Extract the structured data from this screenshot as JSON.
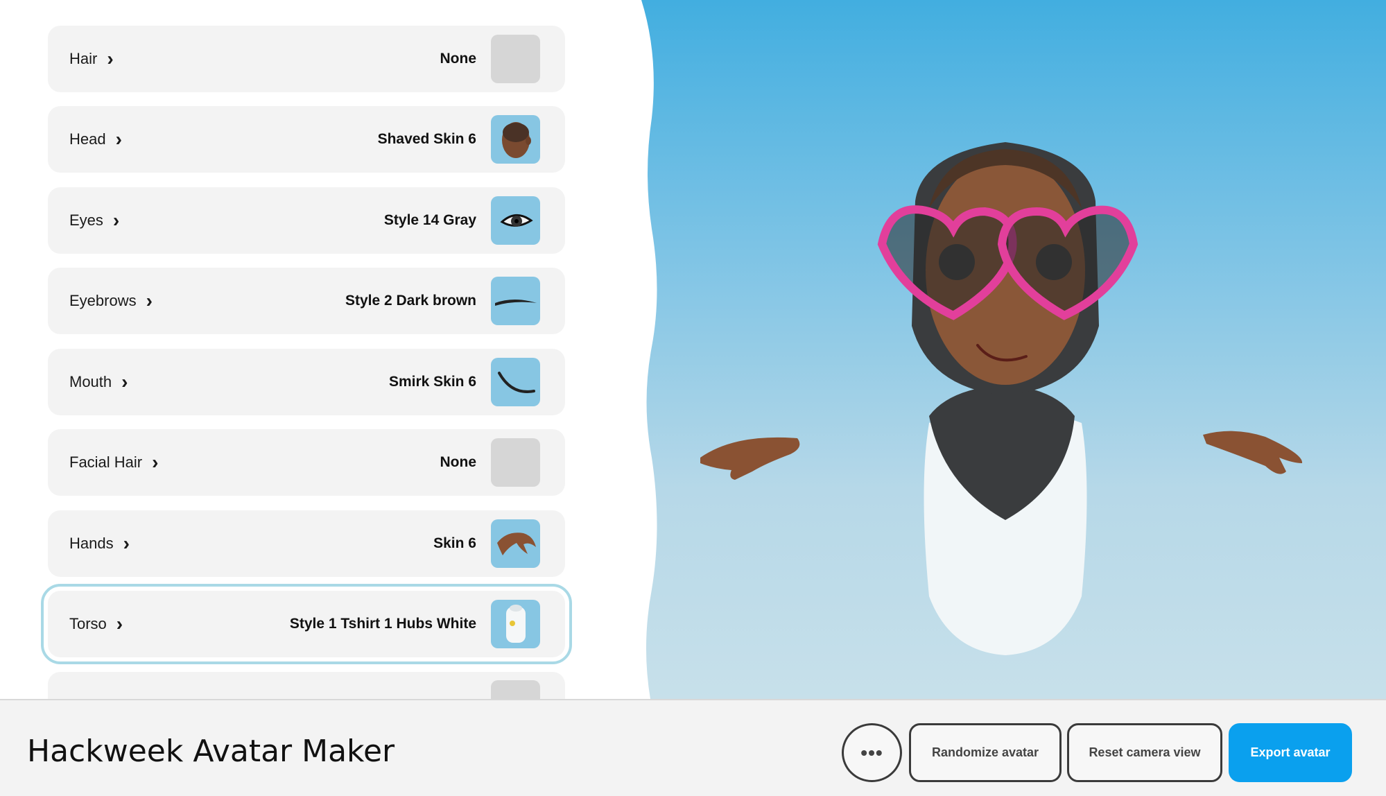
{
  "rows": [
    {
      "label": "Hair",
      "value": "None"
    },
    {
      "label": "Head",
      "value": "Shaved Skin 6"
    },
    {
      "label": "Eyes",
      "value": "Style 14 Gray"
    },
    {
      "label": "Eyebrows",
      "value": "Style 2 Dark brown"
    },
    {
      "label": "Mouth",
      "value": "Smirk Skin 6"
    },
    {
      "label": "Facial Hair",
      "value": "None"
    },
    {
      "label": "Hands",
      "value": "Skin 6"
    },
    {
      "label": "Torso",
      "value": "Style 1 Tshirt 1 Hubs White"
    }
  ],
  "chevron": "›",
  "footer": {
    "title": "Hackweek Avatar Maker",
    "more_label": "•••",
    "randomize_label": "Randomize avatar",
    "reset_label": "Reset camera view",
    "export_label": "Export avatar"
  },
  "colors": {
    "accent": "#0aa0ee",
    "selected_outline": "#a9d9e6",
    "sky_top": "#42aee0",
    "sky_bottom": "#c7e0ea"
  },
  "icons": [
    "chevron-right-icon",
    "head-thumbnail",
    "eye-thumbnail",
    "eyebrow-thumbnail",
    "mouth-thumbnail",
    "hand-thumbnail",
    "tshirt-thumbnail",
    "more-icon"
  ]
}
